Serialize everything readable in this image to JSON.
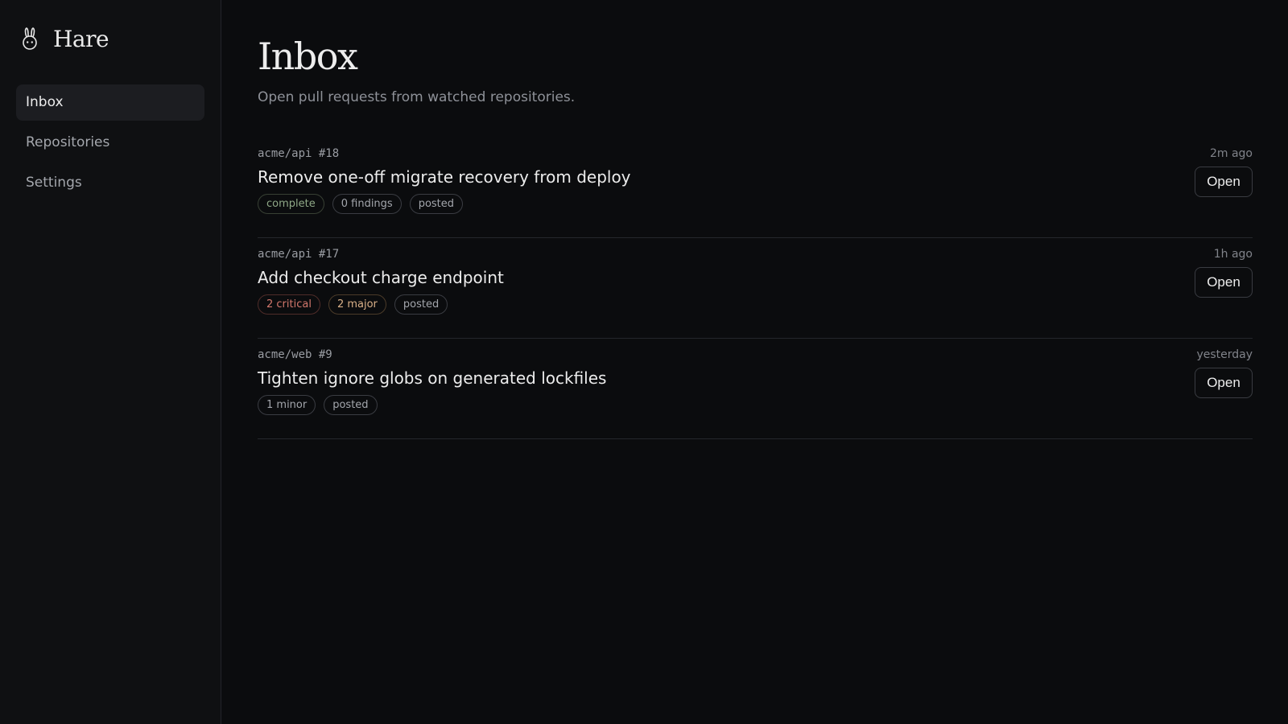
{
  "brand": {
    "name": "Hare",
    "icon": "hare-icon"
  },
  "nav": {
    "items": [
      {
        "label": "Inbox",
        "active": true
      },
      {
        "label": "Repositories",
        "active": false
      },
      {
        "label": "Settings",
        "active": false
      }
    ]
  },
  "page": {
    "title": "Inbox",
    "subtitle": "Open pull requests from watched repositories."
  },
  "pull_requests": [
    {
      "repo": "acme/api #18",
      "title": "Remove one-off migrate recovery from deploy",
      "time": "2m ago",
      "tags": [
        {
          "label": "complete",
          "kind": "complete"
        },
        {
          "label": "0 findings",
          "kind": "neutral"
        },
        {
          "label": "posted",
          "kind": "neutral"
        }
      ],
      "action_label": "Open"
    },
    {
      "repo": "acme/api #17",
      "title": "Add checkout charge endpoint",
      "time": "1h ago",
      "tags": [
        {
          "label": "2 critical",
          "kind": "critical"
        },
        {
          "label": "2 major",
          "kind": "major"
        },
        {
          "label": "posted",
          "kind": "neutral"
        }
      ],
      "action_label": "Open"
    },
    {
      "repo": "acme/web #9",
      "title": "Tighten ignore globs on generated lockfiles",
      "time": "yesterday",
      "tags": [
        {
          "label": "1 minor",
          "kind": "neutral"
        },
        {
          "label": "posted",
          "kind": "neutral"
        }
      ],
      "action_label": "Open"
    }
  ],
  "colors": {
    "background": "#0b0c0e",
    "sidebar": "#0f1012",
    "active_nav": "#1c1d21",
    "complete": "#8fa887",
    "critical": "#d2776c",
    "major": "#d9b088"
  }
}
